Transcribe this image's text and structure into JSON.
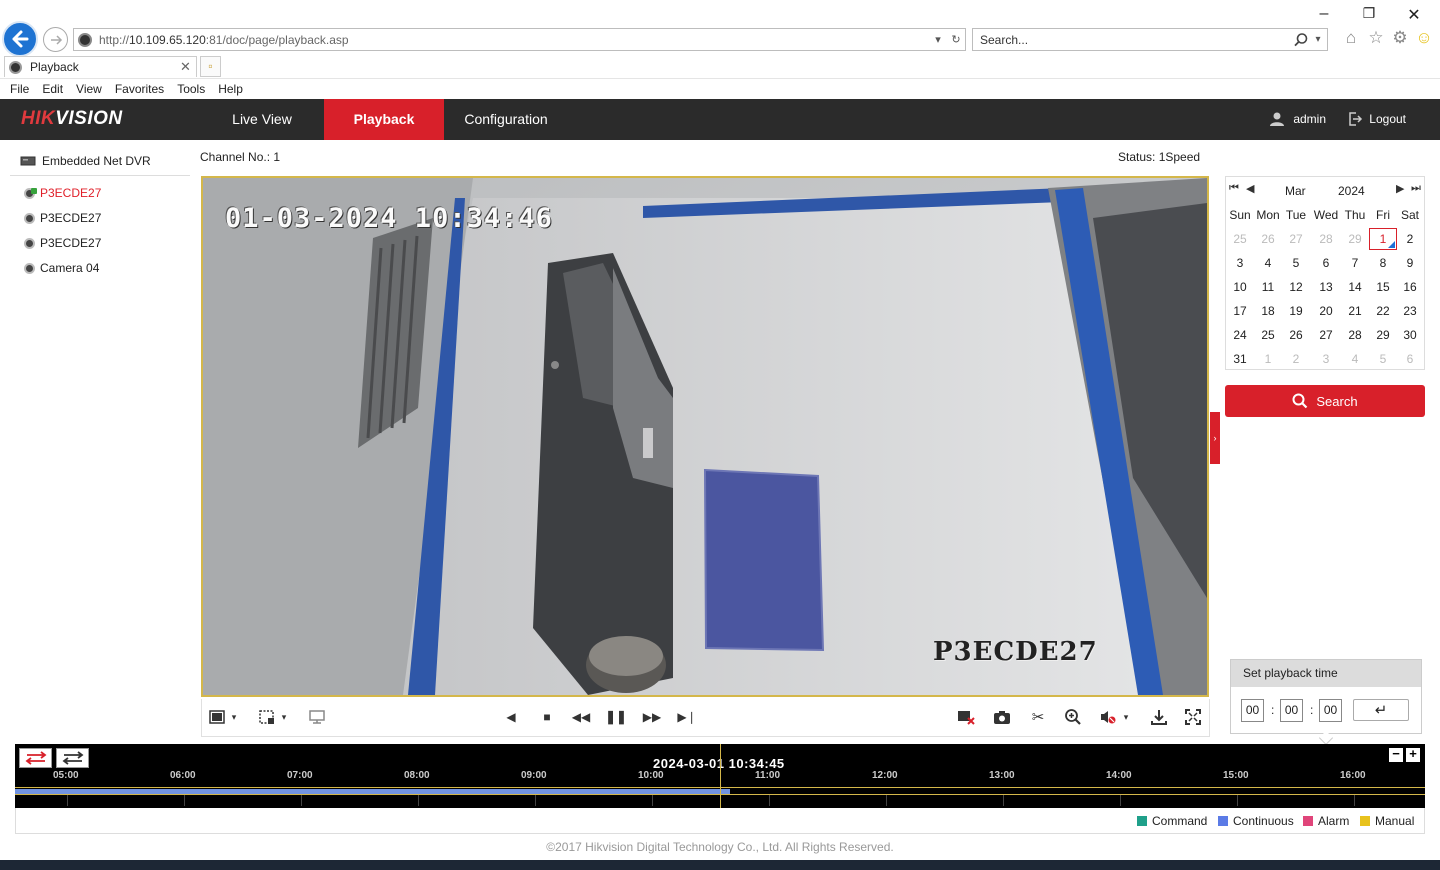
{
  "browser": {
    "url_prefix": "http://",
    "url_host": "10.109.65.120",
    "url_rest": ":81/doc/page/playback.asp",
    "search_placeholder": "Search...",
    "tab_title": "Playback",
    "menu": [
      "File",
      "Edit",
      "View",
      "Favorites",
      "Tools",
      "Help"
    ]
  },
  "header": {
    "logo_red": "HIK",
    "logo_white": "VISION",
    "tabs": [
      "Live View",
      "Playback",
      "Configuration"
    ],
    "active_tab": "Playback",
    "user": "admin",
    "logout": "Logout"
  },
  "tree": {
    "root": "Embedded Net DVR",
    "cameras": [
      "P3ECDE27",
      "P3ECDE27",
      "P3ECDE27",
      "Camera 04"
    ],
    "active_index": 0
  },
  "video": {
    "channel_label": "Channel No.: 1",
    "status_label": "Status: 1Speed",
    "osd_time": "01-03-2024 10:34:46",
    "osd_name": "P3ECDE27"
  },
  "calendar": {
    "month": "Mar",
    "year": "2024",
    "weekdays": [
      "Sun",
      "Mon",
      "Tue",
      "Wed",
      "Thu",
      "Fri",
      "Sat"
    ],
    "weeks": [
      [
        [
          "25",
          1
        ],
        [
          "26",
          1
        ],
        [
          "27",
          1
        ],
        [
          "28",
          1
        ],
        [
          "29",
          1
        ],
        [
          "1",
          2
        ],
        [
          "2",
          0
        ]
      ],
      [
        [
          "3",
          0
        ],
        [
          "4",
          0
        ],
        [
          "5",
          0
        ],
        [
          "6",
          0
        ],
        [
          "7",
          0
        ],
        [
          "8",
          0
        ],
        [
          "9",
          0
        ]
      ],
      [
        [
          "10",
          0
        ],
        [
          "11",
          0
        ],
        [
          "12",
          0
        ],
        [
          "13",
          0
        ],
        [
          "14",
          0
        ],
        [
          "15",
          0
        ],
        [
          "16",
          0
        ]
      ],
      [
        [
          "17",
          0
        ],
        [
          "18",
          0
        ],
        [
          "19",
          0
        ],
        [
          "20",
          0
        ],
        [
          "21",
          0
        ],
        [
          "22",
          0
        ],
        [
          "23",
          0
        ]
      ],
      [
        [
          "24",
          0
        ],
        [
          "25",
          0
        ],
        [
          "26",
          0
        ],
        [
          "27",
          0
        ],
        [
          "28",
          0
        ],
        [
          "29",
          0
        ],
        [
          "30",
          0
        ]
      ],
      [
        [
          "31",
          0
        ],
        [
          "1",
          1
        ],
        [
          "2",
          1
        ],
        [
          "3",
          1
        ],
        [
          "4",
          1
        ],
        [
          "5",
          1
        ],
        [
          "6",
          1
        ]
      ]
    ],
    "search_label": "Search"
  },
  "playback_time": {
    "title": "Set playback time",
    "hh": "00",
    "mm": "00",
    "ss": "00"
  },
  "timeline": {
    "current_time": "2024-03-01 10:34:45",
    "hours": [
      "05:00",
      "06:00",
      "07:00",
      "08:00",
      "09:00",
      "10:00",
      "11:00",
      "12:00",
      "13:00",
      "14:00",
      "15:00",
      "16:00"
    ],
    "recorded_until_fraction": 0.507,
    "legend": [
      {
        "label": "Command",
        "color": "#1fa08a"
      },
      {
        "label": "Continuous",
        "color": "#5b7be6"
      },
      {
        "label": "Alarm",
        "color": "#e0457a"
      },
      {
        "label": "Manual",
        "color": "#e8c21d"
      }
    ]
  },
  "footer": "©2017 Hikvision Digital Technology Co., Ltd. All Rights Reserved.",
  "colors": {
    "accent": "#d8202a",
    "header_bg": "#2b2b2b"
  }
}
